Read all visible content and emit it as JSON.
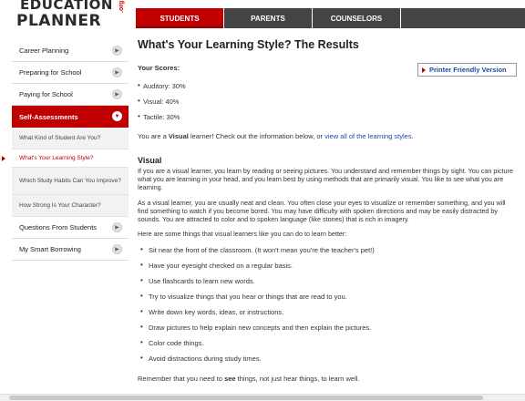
{
  "logo": {
    "line1": "EDUCATION",
    "line2": "PLANNER",
    "suffix": ".org"
  },
  "nav": {
    "tabs": [
      "STUDENTS",
      "PARENTS",
      "COUNSELORS"
    ]
  },
  "sidebar": {
    "items": [
      {
        "label": "Career Planning"
      },
      {
        "label": "Preparing for School"
      },
      {
        "label": "Paying for School"
      },
      {
        "label": "Self-Assessments"
      },
      {
        "label": "Questions From Students"
      },
      {
        "label": "My Smart Borrowing"
      }
    ],
    "subitems": [
      {
        "label": "What Kind of Student Are You?"
      },
      {
        "label": "What's Your Learning Style?"
      },
      {
        "label": "Which Study Habits Can You Improve?"
      },
      {
        "label": "How Strong Is Your Character?"
      }
    ]
  },
  "main": {
    "title": "What's Your Learning Style? The Results",
    "scores_label": "Your Scores:",
    "print_label": "Printer Friendly Version",
    "scores": [
      "Auditory: 30%",
      "Visual: 40%",
      "Tactile: 30%"
    ],
    "learner_pre": "You are a ",
    "learner_bold": "Visual",
    "learner_mid": " learner! Check out the information below, or ",
    "learner_link": "view all of the learning styles",
    "learner_end": ".",
    "visual_heading": "Visual",
    "para1": "If you are a visual learner, you learn by reading or seeing pictures. You understand and remember things by sight. You can picture what you are learning in your head, and you learn best by using methods that are primarily visual. You like to see what you are learning.",
    "para2": "As a visual learner, you are usually neat and clean. You often close your eyes to visualize or remember something, and you will find something to watch if you become bored. You may have difficulty with spoken directions and may be easily distracted by sounds. You are attracted to color and to spoken language (like stories) that is rich in imagery.",
    "para3": "Here are some things that visual learners like you can do to learn better:",
    "tips": [
      "Sit near the front of the classroom. (It won't mean you're the teacher's pet!)",
      "Have your eyesight checked on a regular basis.",
      "Use flashcards to learn new words.",
      "Try to visualize things that you hear or things that are read to you.",
      "Write down key words, ideas, or instructions.",
      "Draw pictures to help explain new concepts and then explain the pictures.",
      "Color code things.",
      "Avoid distractions during study times."
    ],
    "final_pre": "Remember that you need to ",
    "final_bold": "see",
    "final_post": " things, not just hear things, to learn well."
  },
  "colors": {
    "accent": "#c00000",
    "nav_dark": "#444444",
    "link": "#1a4aa8"
  }
}
